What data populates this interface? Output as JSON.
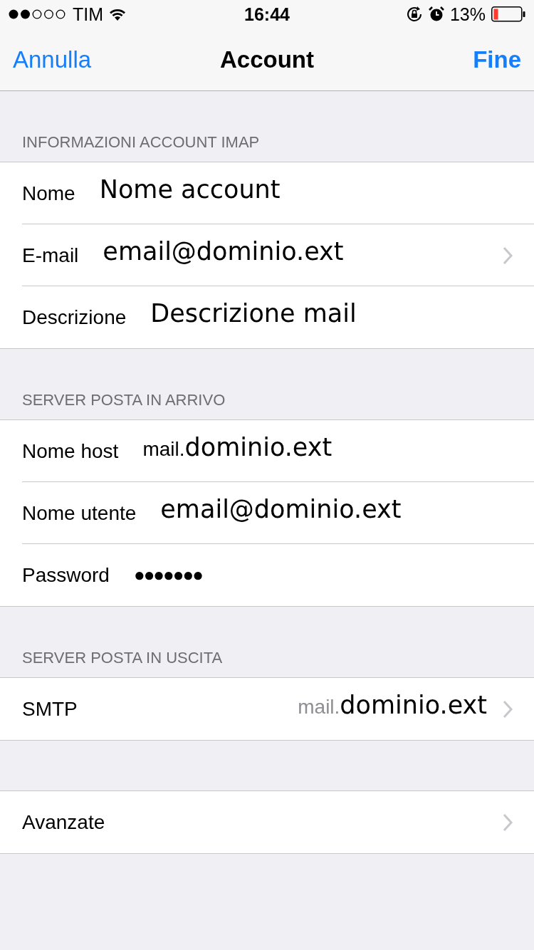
{
  "status_bar": {
    "carrier": "TIM",
    "time": "16:44",
    "battery": "13%"
  },
  "nav_bar": {
    "left_button": "Annulla",
    "title": "Account",
    "right_button": "Fine"
  },
  "sections": [
    {
      "header": "INFORMAZIONI ACCOUNT IMAP",
      "rows": [
        {
          "label": "Nome",
          "kind": "text",
          "value": "Nome account",
          "chevron": false
        },
        {
          "label": "E-mail",
          "kind": "text",
          "value": "email@dominio.ext",
          "chevron": true
        },
        {
          "label": "Descrizione",
          "kind": "text",
          "value": "Descrizione mail",
          "chevron": false
        }
      ]
    },
    {
      "header": "SERVER POSTA IN ARRIVO",
      "rows": [
        {
          "label": "Nome host",
          "kind": "host",
          "prefix": "mail.",
          "prefix_muted": false,
          "value": "dominio.ext",
          "chevron": false
        },
        {
          "label": "Nome utente",
          "kind": "text",
          "value": "email@dominio.ext",
          "chevron": false
        },
        {
          "label": "Password",
          "kind": "password",
          "value": "●●●●●●●",
          "chevron": false
        }
      ]
    },
    {
      "header": "SERVER POSTA IN USCITA",
      "rows": [
        {
          "label": "SMTP",
          "kind": "host",
          "prefix": "mail.",
          "prefix_muted": true,
          "value": "dominio.ext",
          "chevron": true
        }
      ]
    },
    {
      "rows": [
        {
          "label": "Avanzate",
          "kind": "plain",
          "chevron": true
        }
      ]
    }
  ]
}
